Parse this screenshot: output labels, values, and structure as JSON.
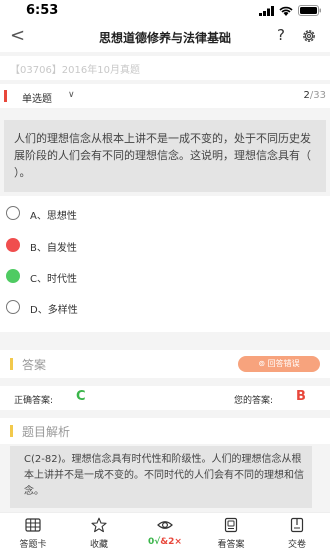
{
  "status": {
    "time": "6:53"
  },
  "nav": {
    "back_glyph": "<",
    "title": "思想道德修养与法律基础",
    "help_glyph": "?",
    "settings_icon": "gear-icon"
  },
  "exam": {
    "title": "【03706】2016年10月真题"
  },
  "question_bar": {
    "type_label": "单选题",
    "chevron": "∨",
    "current": "2",
    "total": "/33"
  },
  "question": {
    "text": "人们的理想信念从根本上讲不是一成不变的，处于不同历史发展阶段的人们会有不同的理想信念。这说明，理想信念具有（ ）。"
  },
  "options": [
    {
      "text": "A、思想性",
      "state": "empty"
    },
    {
      "text": "B、自发性",
      "state": "wrong"
    },
    {
      "text": "C、时代性",
      "state": "right"
    },
    {
      "text": "D、多样性",
      "state": "empty"
    }
  ],
  "answer": {
    "section_title": "答案",
    "report_error": "⊚ 回答错误",
    "correct_label": "正确答案:",
    "correct_value": "C",
    "your_label": "您的答案:",
    "your_value": "B",
    "colors": {
      "correct": "#3ab54a",
      "wrong": "#e8473b"
    }
  },
  "analysis": {
    "section_title": "题目解析",
    "text": "C(2-82)。理想信念具有时代性和阶级性。人们的理想信念从根本上讲并不是一成不变的。不同时代的人们会有不同的理想和信念。"
  },
  "tabbar": {
    "items": [
      {
        "label": "答题卡",
        "icon": "grid-card-icon"
      },
      {
        "label": "收藏",
        "icon": "star-icon"
      },
      {
        "label_ok": "0√",
        "label_bad": "&2×",
        "icon": "eye-icon"
      },
      {
        "label": "看答案",
        "icon": "answer-book-icon"
      },
      {
        "label": "交卷",
        "icon": "submit-paper-icon"
      }
    ]
  }
}
